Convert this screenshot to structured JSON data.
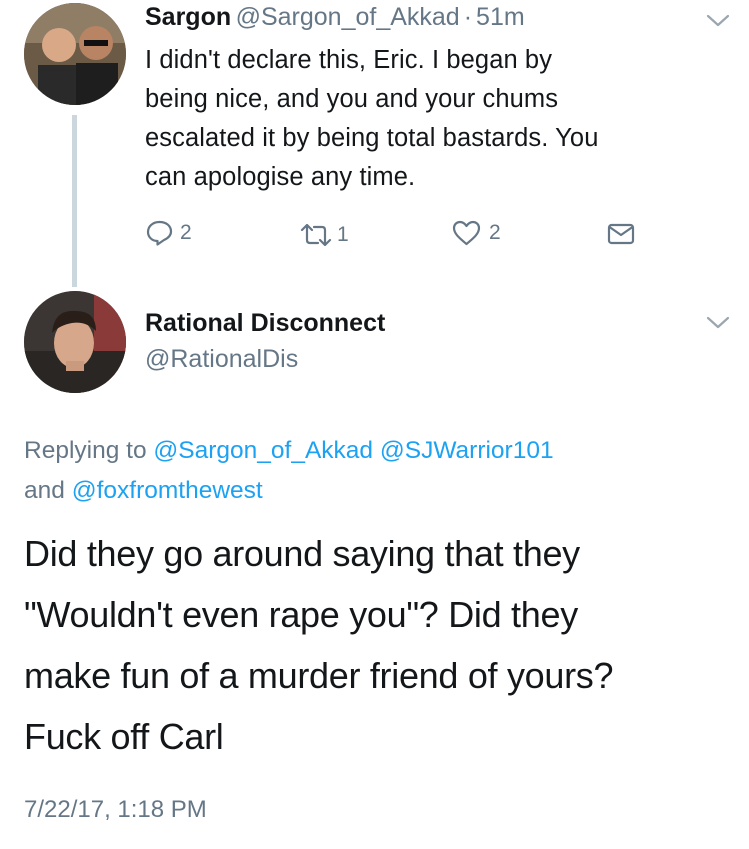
{
  "tweet1": {
    "display_name": "Sargon",
    "handle": "@Sargon_of_Akkad",
    "separator": "·",
    "time": "51m",
    "text_lines": [
      "I didn't declare this, Eric. I began by",
      "being nice, and you and your chums",
      "escalated it by being total bastards. You",
      "can apologise any time."
    ],
    "reply_count": "2",
    "retweet_count": "1",
    "like_count": "2"
  },
  "tweet2": {
    "display_name": "Rational Disconnect",
    "handle": "@RationalDis",
    "replying_prefix": "Replying to",
    "replying_users": [
      "@Sargon_of_Akkad",
      "@SJWarrior101",
      "@foxfromthewest"
    ],
    "replying_and": "and",
    "text_lines": [
      "Did they go around saying that they",
      "\"Wouldn't even rape you\"? Did they",
      "make fun of a murder friend of yours?",
      "Fuck off Carl"
    ],
    "timestamp": "7/22/17, 1:18 PM"
  },
  "colors": {
    "text": "#14171a",
    "muted": "#657786",
    "link": "#1da1f2",
    "thread_line": "#ccd6dd"
  },
  "icons": {
    "reply": "reply-icon",
    "retweet": "retweet-icon",
    "like": "heart-icon",
    "dm": "envelope-icon",
    "menu": "chevron-down-icon"
  }
}
